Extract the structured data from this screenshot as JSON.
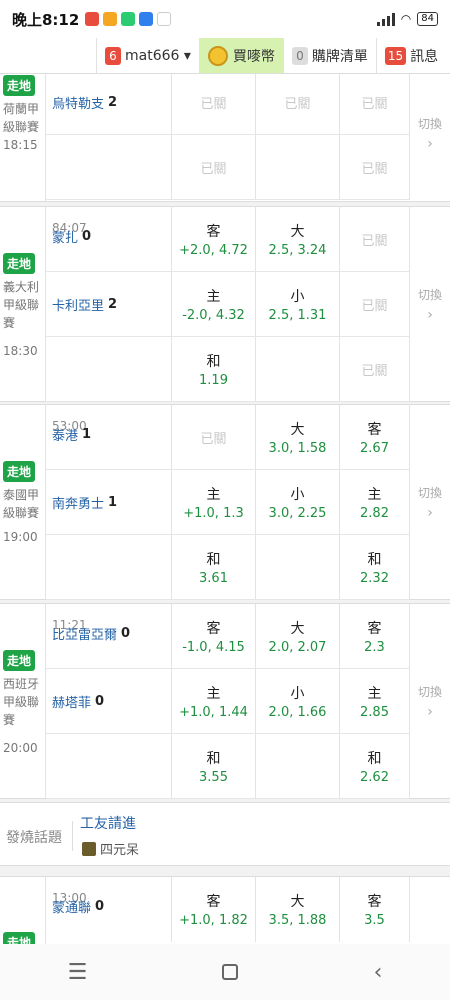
{
  "status_bar": {
    "time": "晚上8:12",
    "battery": "84"
  },
  "topnav": {
    "user": {
      "badge": "6",
      "name": "mat666 ▾"
    },
    "buy": {
      "label": "買嘜幣"
    },
    "cart": {
      "badge": "0",
      "label": "購牌清單"
    },
    "messages": {
      "badge": "15",
      "label": "訊息"
    }
  },
  "common": {
    "live": "走地",
    "closed": "已關",
    "switch": "切換",
    "switch_arrow": "›"
  },
  "matches": [
    {
      "league": "荷蘭甲級聯賽",
      "kickoff": "18:15",
      "clock": "",
      "home": {
        "name": "",
        "score": ""
      },
      "away": {
        "name": "烏特勒支",
        "score": "2"
      }
    },
    {
      "league": "義大利甲級聯賽",
      "kickoff": "18:30",
      "clock": "84:07",
      "team1": {
        "name": "蒙扎",
        "score": "0"
      },
      "team2": {
        "name": "卡利亞里",
        "score": "2"
      },
      "r1": {
        "c1_lbl": "客",
        "c1_val": "+2.0, 4.72",
        "c2_lbl": "大",
        "c2_val": "2.5, 3.24"
      },
      "r2": {
        "c1_lbl": "主",
        "c1_val": "-2.0, 4.32",
        "c2_lbl": "小",
        "c2_val": "2.5, 1.31"
      },
      "r3": {
        "c1_lbl": "和",
        "c1_val": "1.19"
      }
    },
    {
      "league": "泰國甲級聯賽",
      "kickoff": "19:00",
      "clock": "53:00",
      "team1": {
        "name": "泰港",
        "score": "1"
      },
      "team2": {
        "name": "南奔勇士",
        "score": "1"
      },
      "r1": {
        "c2_lbl": "大",
        "c2_val": "3.0, 1.58",
        "c3_lbl": "客",
        "c3_val": "2.67"
      },
      "r2": {
        "c1_lbl": "主",
        "c1_val": "+1.0, 1.3",
        "c2_lbl": "小",
        "c2_val": "3.0, 2.25",
        "c3_lbl": "主",
        "c3_val": "2.82"
      },
      "r3": {
        "c1_lbl": "和",
        "c1_val": "3.61",
        "c3_lbl": "和",
        "c3_val": "2.32"
      }
    },
    {
      "league": "西班牙甲級聯賽",
      "kickoff": "20:00",
      "clock": "11:21",
      "team1": {
        "name": "比亞雷亞爾",
        "score": "0"
      },
      "team2": {
        "name": "赫塔菲",
        "score": "0"
      },
      "r1": {
        "c1_lbl": "客",
        "c1_val": "-1.0, 4.15",
        "c2_lbl": "大",
        "c2_val": "2.0, 2.07",
        "c3_lbl": "客",
        "c3_val": "2.3"
      },
      "r2": {
        "c1_lbl": "主",
        "c1_val": "+1.0, 1.44",
        "c2_lbl": "小",
        "c2_val": "2.0, 1.66",
        "c3_lbl": "主",
        "c3_val": "2.85"
      },
      "r3": {
        "c1_lbl": "和",
        "c1_val": "3.55",
        "c3_lbl": "和",
        "c3_val": "2.62"
      }
    },
    {
      "clock": "13:00",
      "team1": {
        "name": "蒙通聯",
        "score": "0"
      },
      "r1": {
        "c1_lbl": "客",
        "c1_val": "+1.0, 1.82",
        "c2_lbl": "大",
        "c2_val": "3.5, 1.88",
        "c3_lbl": "客",
        "c3_val": "3.5"
      }
    }
  ],
  "topic": {
    "label": "發燒話題",
    "title": "工友請進",
    "user": "四元呆"
  },
  "navbar": {
    "menu": "☰",
    "back": "‹"
  }
}
